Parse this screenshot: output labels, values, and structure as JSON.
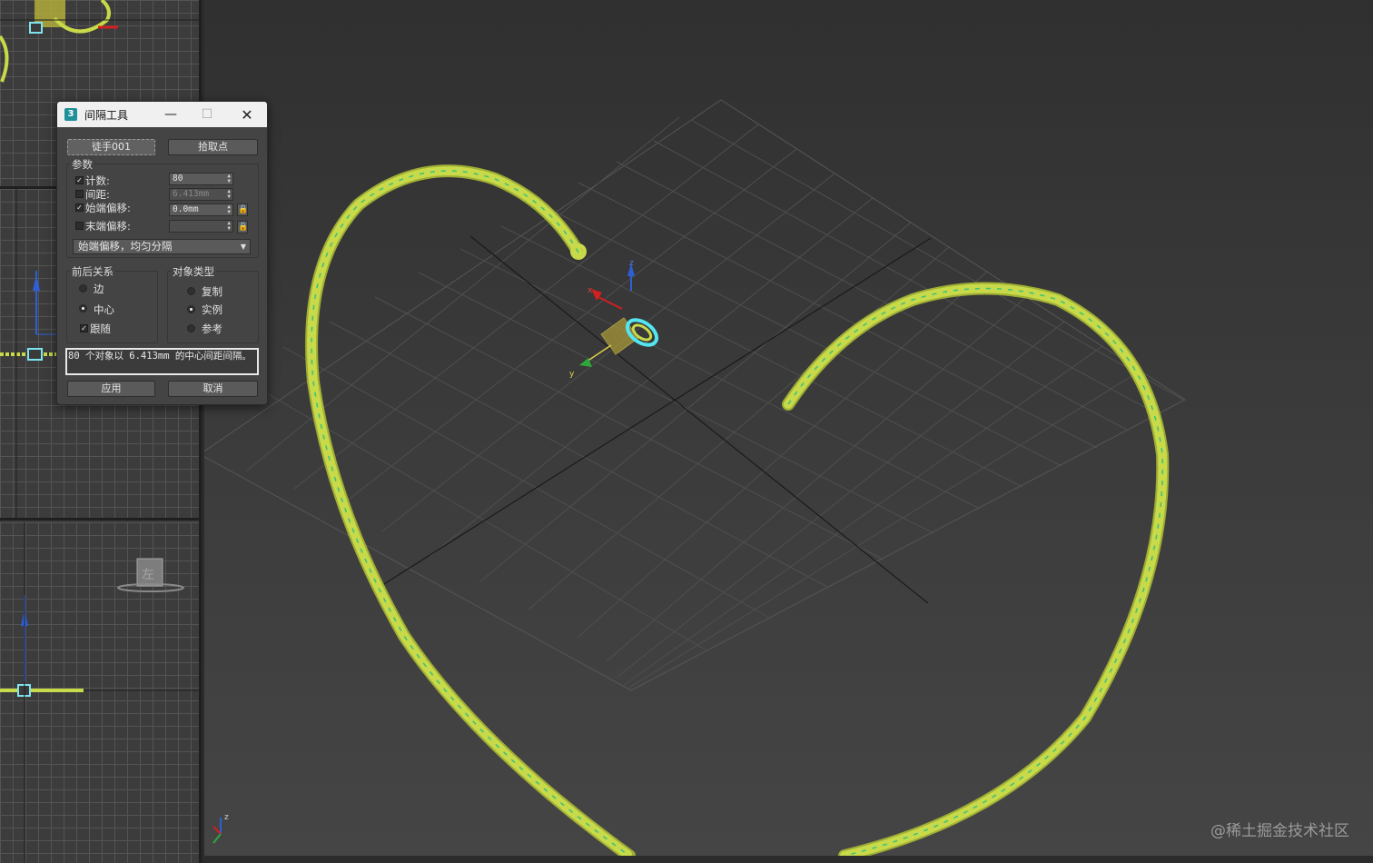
{
  "dialog": {
    "title": "间隔工具",
    "app_icon_label": "3",
    "path_button": "徒手001",
    "pick_points_button": "拾取点",
    "params_label": "参数",
    "count_label": "计数:",
    "count_value": "80",
    "count_checked": true,
    "spacing_label": "间距:",
    "spacing_value": "6.413mm",
    "spacing_checked": false,
    "start_offset_label": "始端偏移:",
    "start_offset_value": "0.0mm",
    "start_offset_checked": true,
    "end_offset_label": "末端偏移:",
    "end_offset_value": "",
    "end_offset_checked": false,
    "distribution_dropdown": "始端偏移，均匀分隔",
    "context_group_label": "前后关系",
    "context_options": [
      "边",
      "中心"
    ],
    "context_selected": "中心",
    "follow_label": "跟随",
    "follow_checked": true,
    "object_type_group_label": "对象类型",
    "object_type_options": [
      "复制",
      "实例",
      "参考"
    ],
    "object_type_selected": "实例",
    "status_text": "80 个对象以 6.413mm  的中心间距间隔。",
    "apply_button": "应用",
    "cancel_button": "取消"
  },
  "viewport": {
    "watermark": "@稀土掘金技术社区",
    "axis_x": "x",
    "axis_y": "y",
    "axis_z": "z",
    "chain_color": "#c8d94a",
    "chain_highlight": "#39c27a",
    "selection_color": "#54e6f0"
  },
  "left_viewports": {
    "left_cube_label": "左"
  }
}
